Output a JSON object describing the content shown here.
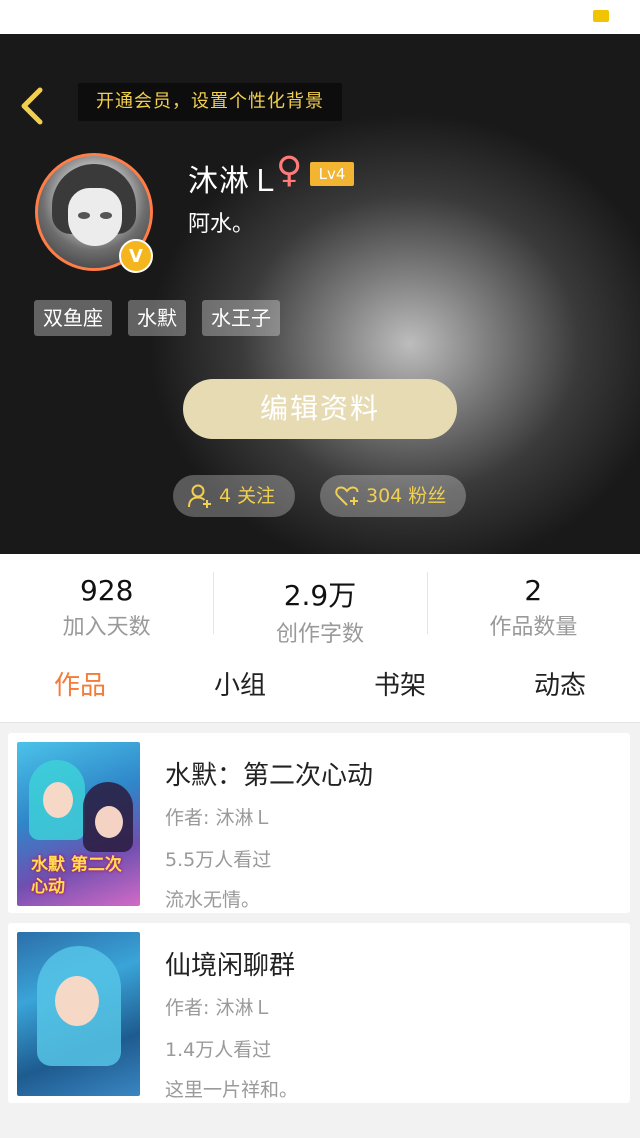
{
  "header": {
    "bg_tip": "开通会员，设置个性化背景"
  },
  "profile": {
    "username": "沐淋Ｌ",
    "gender_symbol": "♀",
    "level": "Lv4",
    "signature": "阿水。",
    "vip_mark": "V",
    "tags": [
      "双鱼座",
      "水默",
      "水王子"
    ],
    "edit_label": "编辑资料",
    "follow_label": "4 关注",
    "fans_label": "304 粉丝"
  },
  "stats": [
    {
      "value": "928",
      "label": "加入天数"
    },
    {
      "value": "2.9万",
      "label": "创作字数"
    },
    {
      "value": "2",
      "label": "作品数量"
    }
  ],
  "tabs": [
    {
      "label": "作品",
      "active": true
    },
    {
      "label": "小组",
      "active": false
    },
    {
      "label": "书架",
      "active": false
    },
    {
      "label": "动态",
      "active": false
    }
  ],
  "works": [
    {
      "title": "水默：第二次心动",
      "author": "作者: 沐淋Ｌ",
      "views": "5.5万人看过",
      "desc": "流水无情。",
      "cover_text": "水默 第二次心动"
    },
    {
      "title": "仙境闲聊群",
      "author": "作者: 沐淋Ｌ",
      "views": "1.4万人看过",
      "desc": "这里一片祥和。"
    }
  ],
  "colors": {
    "accent": "#f47b3a",
    "gold": "#f1cf4f",
    "level_badge": "#f2b431",
    "edit_button": "#e7dbb4",
    "avatar_ring": "#ff7d47"
  },
  "icons": {
    "back": "chevron-left-icon",
    "follow": "user-plus-icon",
    "fans": "heart-plus-icon",
    "vip": "vip-badge-icon"
  }
}
